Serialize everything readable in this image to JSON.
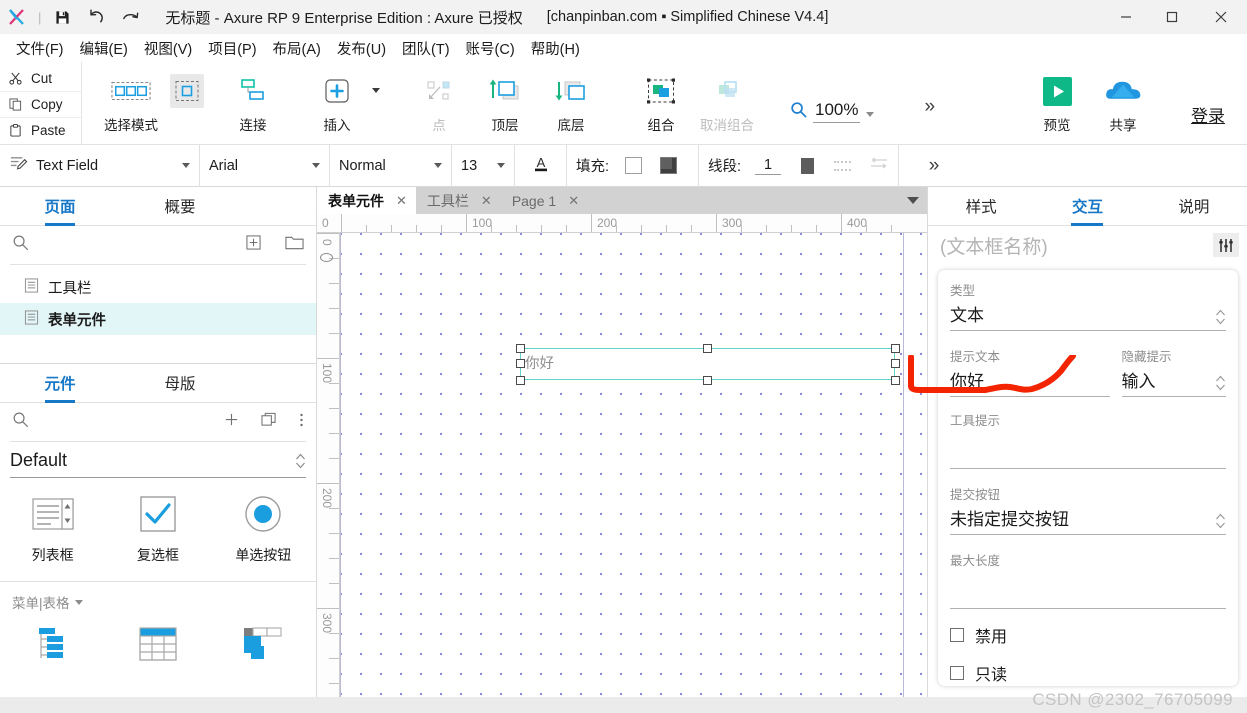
{
  "titlebar": {
    "logo_icon": "axure-x-logo-icon",
    "save_icon": "save-icon",
    "undo_icon": "undo-icon",
    "redo_icon": "redo-icon",
    "title": "无标题 - Axure RP 9 Enterprise Edition : Axure 已授权",
    "subtitle": "[chanpinban.com ▪ Simplified Chinese V4.4]",
    "minimize_label": "—",
    "maximize_label": "□",
    "close_label": "✕"
  },
  "menubar": {
    "items": [
      {
        "label": "文件(F)"
      },
      {
        "label": "编辑(E)"
      },
      {
        "label": "视图(V)"
      },
      {
        "label": "项目(P)"
      },
      {
        "label": "布局(A)"
      },
      {
        "label": "发布(U)"
      },
      {
        "label": "团队(T)"
      },
      {
        "label": "账号(C)"
      },
      {
        "label": "帮助(H)"
      }
    ]
  },
  "toolbar": {
    "clipboard": [
      {
        "label": "Cut",
        "icon": "scissors-icon"
      },
      {
        "label": "Copy",
        "icon": "copy-icon"
      },
      {
        "label": "Paste",
        "icon": "clipboard-icon"
      }
    ],
    "buttons": [
      {
        "label": "选择模式",
        "icon": "select-mode-icon",
        "enabled": true
      },
      {
        "label": "连接",
        "icon": "connect-icon",
        "enabled": true
      },
      {
        "label": "插入",
        "icon": "insert-plus-icon",
        "enabled": true
      },
      {
        "label": "点",
        "icon": "point-icon",
        "enabled": false
      },
      {
        "label": "顶层",
        "icon": "bring-to-front-icon",
        "enabled": true
      },
      {
        "label": "底层",
        "icon": "send-to-back-icon",
        "enabled": true
      },
      {
        "label": "组合",
        "icon": "group-icon",
        "enabled": true
      },
      {
        "label": "取消组合",
        "icon": "ungroup-icon",
        "enabled": false
      }
    ],
    "zoom": {
      "icon": "magnifier-icon",
      "value": "100%"
    },
    "overflow_label": "»",
    "preview": {
      "label": "预览",
      "icon": "play-button-icon",
      "color": "#0fb887"
    },
    "share": {
      "label": "共享",
      "icon": "cloud-icon",
      "color": "#2196e0"
    },
    "login_label": "登录"
  },
  "styletoolbar": {
    "widget_type_icon": "text-field-style-icon",
    "widget_type": "Text Field",
    "font_family": "Arial",
    "font_weight": "Normal",
    "font_size": "13",
    "font_color_icon": "font-color-A-icon",
    "fill_label": "填充:",
    "line_label": "线段:",
    "line_width": "1",
    "overflow_label": "»"
  },
  "left_panel": {
    "tabs": [
      {
        "label": "页面",
        "active": true
      },
      {
        "label": "概要",
        "active": false
      }
    ],
    "search_icon": "search-icon",
    "add_page_icon": "add-page-icon",
    "add_folder_icon": "new-folder-icon",
    "pages": [
      {
        "label": "工具栏",
        "icon": "page-icon",
        "selected": false
      },
      {
        "label": "表单元件",
        "icon": "page-icon",
        "selected": true
      }
    ],
    "library_tabs": [
      {
        "label": "元件",
        "active": true
      },
      {
        "label": "母版",
        "active": false
      }
    ],
    "lib_search_icon": "search-icon",
    "lib_add_icon": "plus-icon",
    "lib_copy_icon": "duplicate-icon",
    "lib_more_icon": "more-vertical-icon",
    "library_name": "Default",
    "widgets_row1": [
      {
        "label": "列表框",
        "icon": "list-box-icon"
      },
      {
        "label": "复选框",
        "icon": "checkbox-icon"
      },
      {
        "label": "单选按钮",
        "icon": "radio-button-icon"
      }
    ],
    "section_title": "菜单|表格",
    "widgets_row2": [
      {
        "label": "",
        "icon": "tree-menu-icon"
      },
      {
        "label": "",
        "icon": "table-icon"
      },
      {
        "label": "",
        "icon": "horizontal-menu-icon"
      }
    ]
  },
  "canvas": {
    "tabs": [
      {
        "label": "表单元件",
        "active": true,
        "close": "✕"
      },
      {
        "label": "工具栏",
        "active": false,
        "close": "✕"
      },
      {
        "label": "Page 1",
        "active": false,
        "close": "✕"
      }
    ],
    "origin_icon": "origin-target-icon",
    "ruler_h_labels": [
      "0",
      "100",
      "200",
      "300",
      "400"
    ],
    "ruler_v_labels": [
      "0",
      "100",
      "200",
      "300"
    ],
    "selected_widget": {
      "name": "text-field-widget",
      "placeholder_text": "你好",
      "border_color": "#62d0cb"
    }
  },
  "right_panel": {
    "tabs": [
      {
        "label": "样式",
        "active": false
      },
      {
        "label": "交互",
        "active": true
      },
      {
        "label": "说明",
        "active": false
      }
    ],
    "name_placeholder": "(文本框名称)",
    "sliders_icon": "sliders-icon",
    "fields": {
      "type_label": "类型",
      "type_value": "文本",
      "hint_label": "提示文本",
      "hint_value": "你好",
      "hide_hint_label": "隐藏提示",
      "hide_hint_value": "输入",
      "tooltip_label": "工具提示",
      "tooltip_value": "",
      "submit_label": "提交按钮",
      "submit_value": "未指定提交按钮",
      "maxlength_label": "最大长度",
      "maxlength_value": ""
    },
    "checkboxes": [
      {
        "label": "禁用",
        "checked": false
      },
      {
        "label": "只读",
        "checked": false
      }
    ]
  },
  "annotation": {
    "color": "#f42400"
  },
  "watermark": {
    "text": "CSDN @2302_76705099"
  }
}
